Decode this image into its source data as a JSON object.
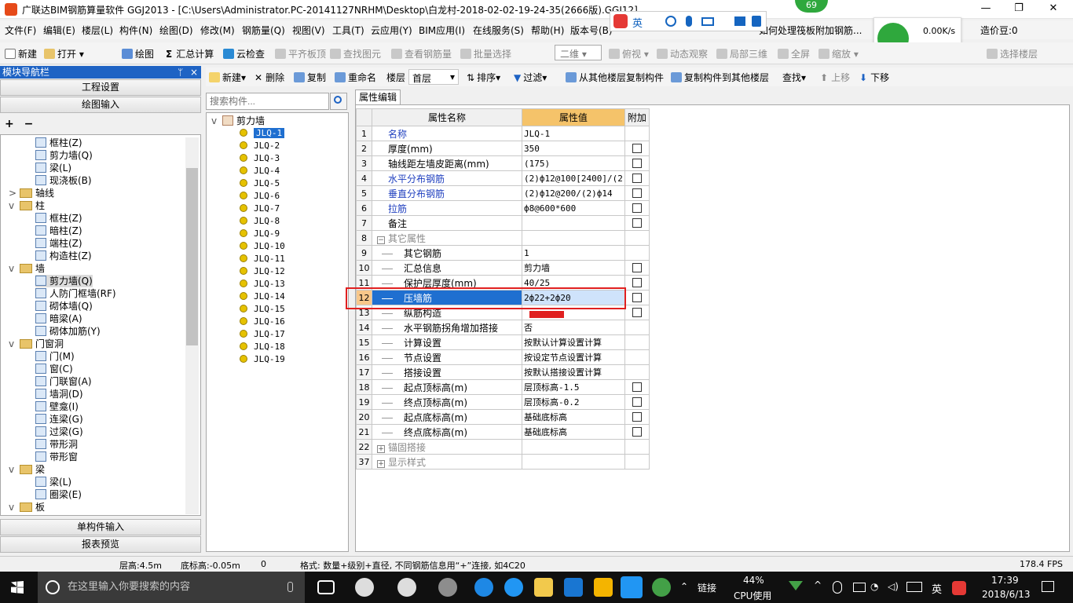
{
  "title": {
    "app": "广联达BIM钢筋算量软件 GGJ2013 - [C:\\Users\\Administrator.PC-20141127NRHM\\Desktop\\白龙村-2018-02-02-19-24-35(2666版).GGJ12]"
  },
  "menu": [
    "文件(F)",
    "编辑(E)",
    "楼层(L)",
    "构件(N)",
    "绘图(D)",
    "修改(M)",
    "钢筋量(Q)",
    "视图(V)",
    "工具(T)",
    "云应用(Y)",
    "BIM应用(I)",
    "在线服务(S)",
    "帮助(H)",
    "版本号(B)"
  ],
  "menu_right": {
    "notice": "如何处理筏板附加钢筋...",
    "price": "造价豆:0"
  },
  "toolbar1": [
    "新建",
    "打开",
    "绘图",
    "汇总计算",
    "云检查",
    "平齐板顶",
    "查找图元",
    "查看钢筋量",
    "批量选择",
    "二维",
    "俯视",
    "动态观察",
    "局部三维",
    "全屏",
    "缩放",
    "选择楼层"
  ],
  "nav": {
    "header": "模块导航栏",
    "project_settings": "工程设置",
    "draw_input": "绘图输入",
    "single_input": "单构件输入",
    "report_preview": "报表预览"
  },
  "nav_tree": [
    {
      "label": "框柱(Z)",
      "indent": 2
    },
    {
      "label": "剪力墙(Q)",
      "indent": 2
    },
    {
      "label": "梁(L)",
      "indent": 2
    },
    {
      "label": "现浇板(B)",
      "indent": 2
    },
    {
      "label": "轴线",
      "indent": 0,
      "folder": true,
      "exp": ">"
    },
    {
      "label": "柱",
      "indent": 0,
      "folder": true,
      "exp": "v"
    },
    {
      "label": "框柱(Z)",
      "indent": 2
    },
    {
      "label": "暗柱(Z)",
      "indent": 2
    },
    {
      "label": "端柱(Z)",
      "indent": 2
    },
    {
      "label": "构造柱(Z)",
      "indent": 2
    },
    {
      "label": "墙",
      "indent": 0,
      "folder": true,
      "exp": "v"
    },
    {
      "label": "剪力墙(Q)",
      "indent": 2,
      "selected": true
    },
    {
      "label": "人防门框墙(RF)",
      "indent": 2
    },
    {
      "label": "砌体墙(Q)",
      "indent": 2
    },
    {
      "label": "暗梁(A)",
      "indent": 2
    },
    {
      "label": "砌体加筋(Y)",
      "indent": 2
    },
    {
      "label": "门窗洞",
      "indent": 0,
      "folder": true,
      "exp": "v"
    },
    {
      "label": "门(M)",
      "indent": 2
    },
    {
      "label": "窗(C)",
      "indent": 2
    },
    {
      "label": "门联窗(A)",
      "indent": 2
    },
    {
      "label": "墙洞(D)",
      "indent": 2
    },
    {
      "label": "壁龛(I)",
      "indent": 2
    },
    {
      "label": "连梁(G)",
      "indent": 2
    },
    {
      "label": "过梁(G)",
      "indent": 2
    },
    {
      "label": "带形洞",
      "indent": 2
    },
    {
      "label": "带形窗",
      "indent": 2
    },
    {
      "label": "梁",
      "indent": 0,
      "folder": true,
      "exp": "v"
    },
    {
      "label": "梁(L)",
      "indent": 2
    },
    {
      "label": "圈梁(E)",
      "indent": 2
    },
    {
      "label": "板",
      "indent": 0,
      "folder": true,
      "exp": "v"
    }
  ],
  "toolbar2": {
    "new": "新建",
    "delete": "删除",
    "copy": "复制",
    "rename": "重命名",
    "floor_label": "楼层",
    "floor_value": "首层",
    "sort": "排序",
    "filter": "过滤",
    "copy_from": "从其他楼层复制构件",
    "copy_to": "复制构件到其他楼层",
    "find": "查找",
    "up": "上移",
    "down": "下移"
  },
  "search": {
    "placeholder": "搜索构件..."
  },
  "component_tree": {
    "root": "剪力墙",
    "items": [
      "JLQ-1",
      "JLQ-2",
      "JLQ-3",
      "JLQ-4",
      "JLQ-5",
      "JLQ-6",
      "JLQ-7",
      "JLQ-8",
      "JLQ-9",
      "JLQ-10",
      "JLQ-11",
      "JLQ-12",
      "JLQ-13",
      "JLQ-14",
      "JLQ-15",
      "JLQ-16",
      "JLQ-17",
      "JLQ-18",
      "JLQ-19"
    ]
  },
  "property": {
    "tab": "属性编辑",
    "headers": {
      "name": "属性名称",
      "value": "属性值",
      "add": "附加"
    },
    "rows": [
      {
        "n": "1",
        "name": "名称",
        "value": "JLQ-1",
        "blue": true,
        "cb": false
      },
      {
        "n": "2",
        "name": "厚度(mm)",
        "value": "350",
        "cb": true
      },
      {
        "n": "3",
        "name": "轴线距左墙皮距离(mm)",
        "value": "(175)",
        "cb": true
      },
      {
        "n": "4",
        "name": "水平分布钢筋",
        "value": "(2)ф12@100[2400]/(2",
        "blue": true,
        "cb": true
      },
      {
        "n": "5",
        "name": "垂直分布钢筋",
        "value": "(2)ф12@200/(2)ф14",
        "blue": true,
        "cb": true
      },
      {
        "n": "6",
        "name": "拉筋",
        "value": "ф8@600*600",
        "blue": true,
        "cb": true
      },
      {
        "n": "7",
        "name": "备注",
        "value": "",
        "cb": true
      },
      {
        "n": "8",
        "name": "其它属性",
        "value": "",
        "gray": true,
        "group": "−"
      },
      {
        "n": "9",
        "name": "其它钢筋",
        "value": "1",
        "sub": true
      },
      {
        "n": "10",
        "name": "汇总信息",
        "value": "剪力墙",
        "sub": true,
        "cb": true
      },
      {
        "n": "11",
        "name": "保护层厚度(mm)",
        "value": "40/25",
        "sub": true,
        "cb": true
      },
      {
        "n": "12",
        "name": "压墙筋",
        "value": "2ф22+2ф20",
        "sub": true,
        "cb": true,
        "hl": true
      },
      {
        "n": "13",
        "name": "纵筋构造",
        "value": "",
        "sub": true,
        "cb": true
      },
      {
        "n": "14",
        "name": "水平钢筋拐角增加搭接",
        "value": "否",
        "sub": true
      },
      {
        "n": "15",
        "name": "计算设置",
        "value": "按默认计算设置计算",
        "sub": true
      },
      {
        "n": "16",
        "name": "节点设置",
        "value": "按设定节点设置计算",
        "sub": true
      },
      {
        "n": "17",
        "name": "搭接设置",
        "value": "按默认搭接设置计算",
        "sub": true
      },
      {
        "n": "18",
        "name": "起点顶标高(m)",
        "value": "层顶标高-1.5",
        "sub": true,
        "cb": true
      },
      {
        "n": "19",
        "name": "终点顶标高(m)",
        "value": "层顶标高-0.2",
        "sub": true,
        "cb": true
      },
      {
        "n": "20",
        "name": "起点底标高(m)",
        "value": "基础底标高",
        "sub": true,
        "cb": true
      },
      {
        "n": "21",
        "name": "终点底标高(m)",
        "value": "基础底标高",
        "sub": true,
        "cb": true
      },
      {
        "n": "22",
        "name": "锚固搭接",
        "value": "",
        "gray": true,
        "group": "+"
      },
      {
        "n": "37",
        "name": "显示样式",
        "value": "",
        "gray": true,
        "group": "+"
      }
    ]
  },
  "status": {
    "floor_height": "层高:4.5m",
    "base_elev": "底标高:-0.05m",
    "zero": "0",
    "hint": "格式: 数量+级别+直径, 不同钢筋信息用“+”连接, 如4C20",
    "fps": "178.4 FPS"
  },
  "taskbar": {
    "search_placeholder": "在这里输入你要搜索的内容",
    "link": "链接",
    "cpu_pct": "44%",
    "cpu_label": "CPU使用",
    "ime": "英",
    "time": "17:39",
    "date": "2018/6/13"
  },
  "popup": {
    "badge": "69",
    "speed": "0.00K/s",
    "count": "0"
  },
  "colors": {
    "accent": "#1e63c4",
    "highlight_red": "#e02020",
    "value_header": "#f5c36a"
  }
}
